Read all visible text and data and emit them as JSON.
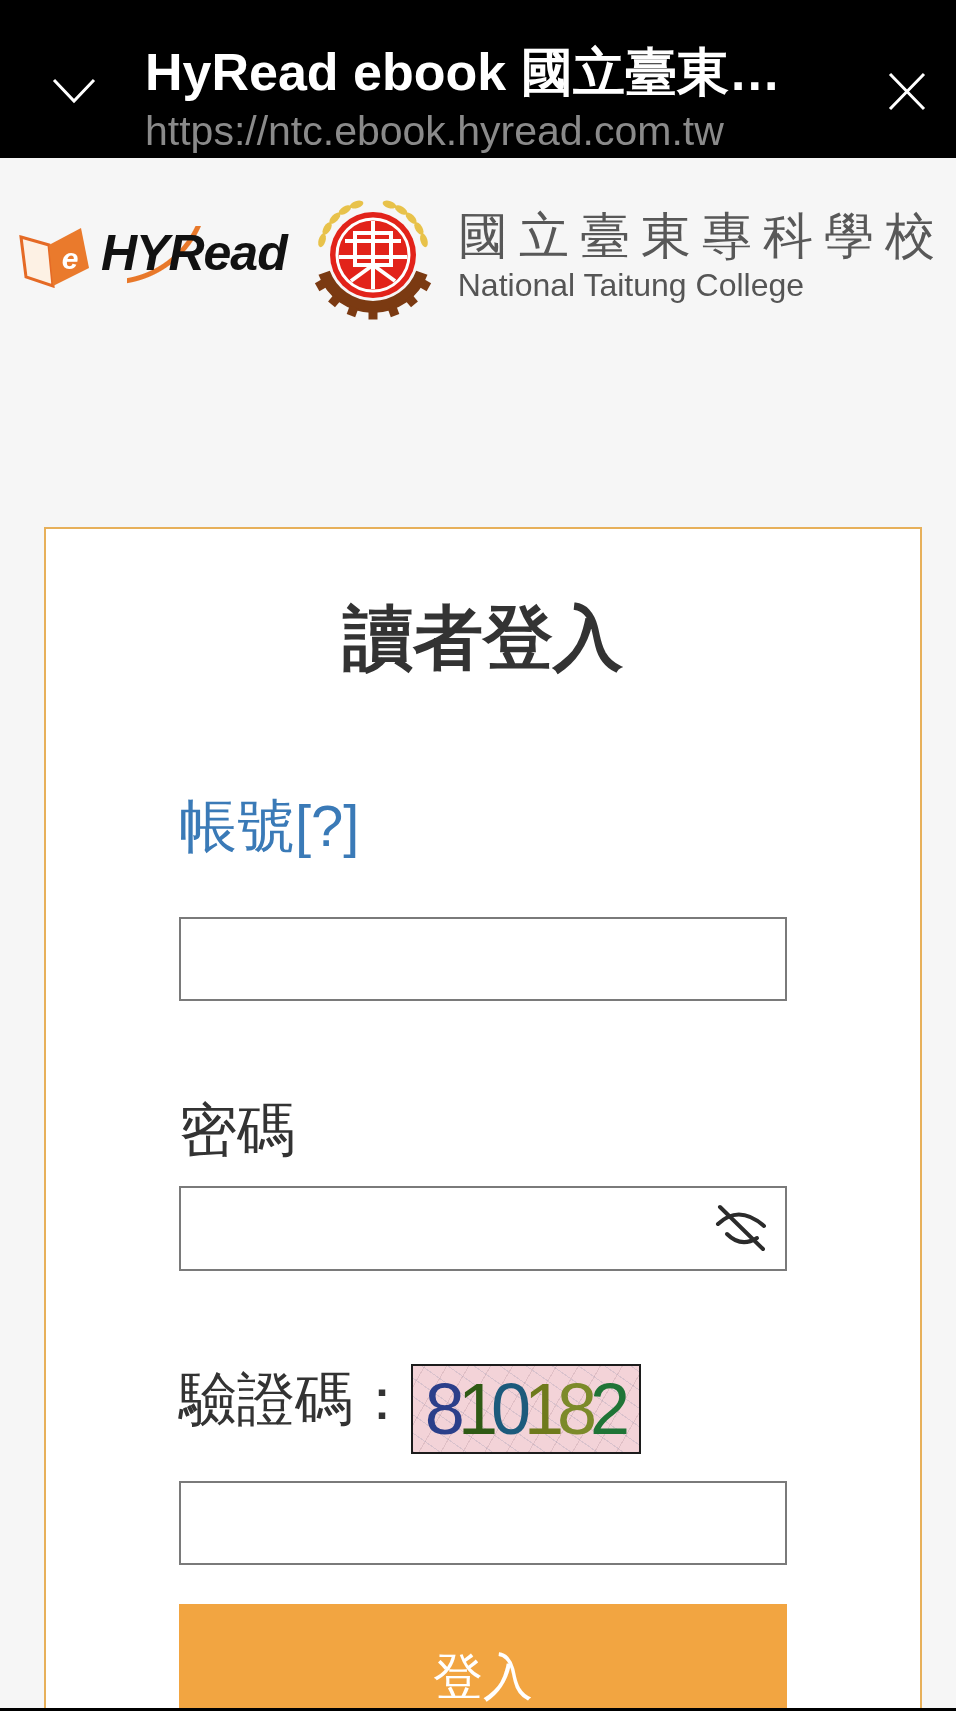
{
  "browser_bar": {
    "title": "HyRead ebook 國立臺東…",
    "url": "https://ntc.ebook.hyread.com.tw"
  },
  "header": {
    "logo_badge": "e",
    "logo_wordmark": "HYRead",
    "school_name": "國立臺東專科學校",
    "school_name_en": "National Taitung College"
  },
  "login": {
    "title": "讀者登入",
    "fields": [
      {
        "kind": "account",
        "label": "帳號[?]"
      },
      {
        "kind": "password",
        "label": "密碼"
      },
      {
        "kind": "captcha",
        "label": "驗證碼：",
        "captcha_code": "810182"
      }
    ],
    "submit": "登入"
  }
}
